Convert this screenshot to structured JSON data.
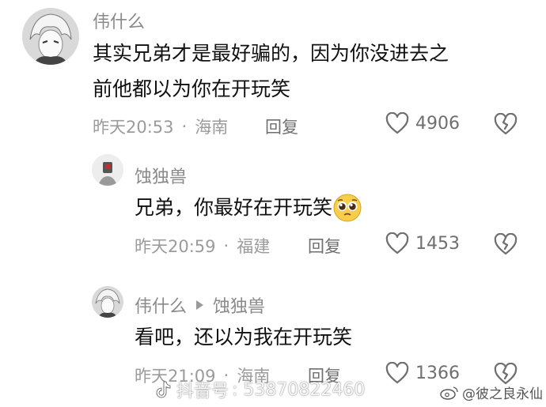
{
  "comments": [
    {
      "username": "伟什么",
      "text_line1": "其实兄弟才是最好骗的，因为你没进去之",
      "text_line2": "前他都以为你在开玩笑",
      "time": "昨天20:53",
      "dot": "·",
      "location": "海南",
      "reply_label": "回复",
      "likes": "4906"
    },
    {
      "username": "蚀独兽",
      "text": "兄弟，你最好在开玩笑",
      "emoji": "🥺",
      "time": "昨天20:59",
      "dot": "·",
      "location": "福建",
      "reply_label": "回复",
      "likes": "1453"
    },
    {
      "username": "伟什么",
      "reply_to": "蚀独兽",
      "text": "看吧，还以为我在开玩笑",
      "time": "昨天21:09",
      "dot": "·",
      "location": "海南",
      "reply_label": "回复",
      "likes": "1366"
    }
  ],
  "watermark": {
    "platform": "抖音号",
    "id": ": 53870822460"
  },
  "weibo_credit": "@彼之良永仙",
  "icons": {
    "like": "heart-outline-icon",
    "dislike": "broken-heart-icon",
    "douyin": "douyin-logo-icon",
    "weibo": "weibo-logo-icon"
  },
  "colors": {
    "text": "#111111",
    "meta": "#9b9b9b",
    "username": "#8a8a8a"
  }
}
